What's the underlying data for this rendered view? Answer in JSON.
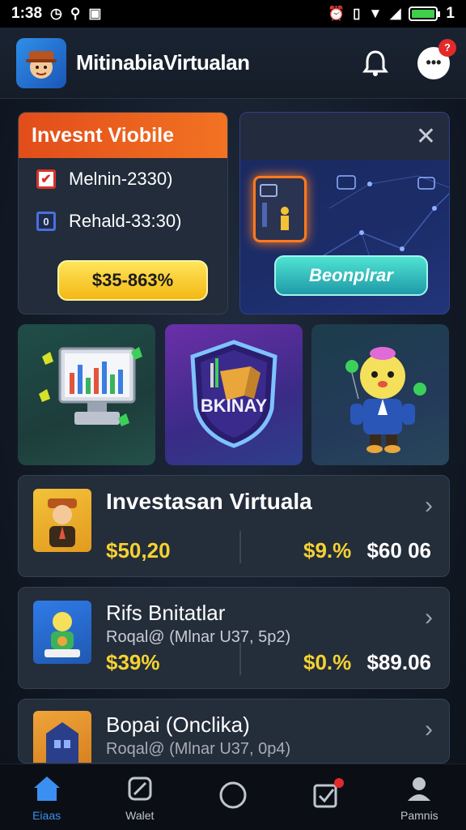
{
  "status_bar": {
    "time": "1:38",
    "right_label": "1",
    "battery_color": "#3fd04a"
  },
  "header": {
    "app_title": "MitinabiaVirtualan",
    "logo_icon": "investor-avatar-icon",
    "chat_badge": "?"
  },
  "promo": {
    "title": "Invesnt Viobile",
    "options": [
      {
        "label": "Melnin-2330)",
        "checked": true
      },
      {
        "label": "Rehald-33:30)",
        "checked": false
      }
    ],
    "yellow_button": "$35-863%",
    "blue_button": "Beonplrar"
  },
  "tiles": [
    {
      "icon": "monitor-chart-icon"
    },
    {
      "icon": "shield-badge-icon",
      "label": "BKINAY"
    },
    {
      "icon": "mascot-icon"
    }
  ],
  "list": [
    {
      "title": "Investasan Virtuala",
      "subtitle": "",
      "left_value": "$50,20",
      "mid_value": "$9.%",
      "right_value": "$60 06"
    },
    {
      "title": "Rifs Bnitatlar",
      "subtitle": "Roqal@ (Mlnar U37, 5p2)",
      "left_value": "$39%",
      "mid_value": "$0.%",
      "right_value": "$89.06"
    },
    {
      "title": "Bopai (Onclika)",
      "subtitle": "Roqal@ (Mlnar U37, 0p4)",
      "left_value": "",
      "mid_value": "",
      "right_value": ""
    }
  ],
  "bottom_nav": [
    {
      "label": "Eiaas",
      "icon": "home-icon",
      "active": true
    },
    {
      "label": "Walet",
      "icon": "wallet-leaf-icon",
      "active": false
    },
    {
      "label": "",
      "icon": "circle-icon",
      "active": false
    },
    {
      "label": "",
      "icon": "checkbox-icon",
      "active": false,
      "badge": true
    },
    {
      "label": "Pamnis",
      "icon": "person-icon",
      "active": false
    }
  ]
}
